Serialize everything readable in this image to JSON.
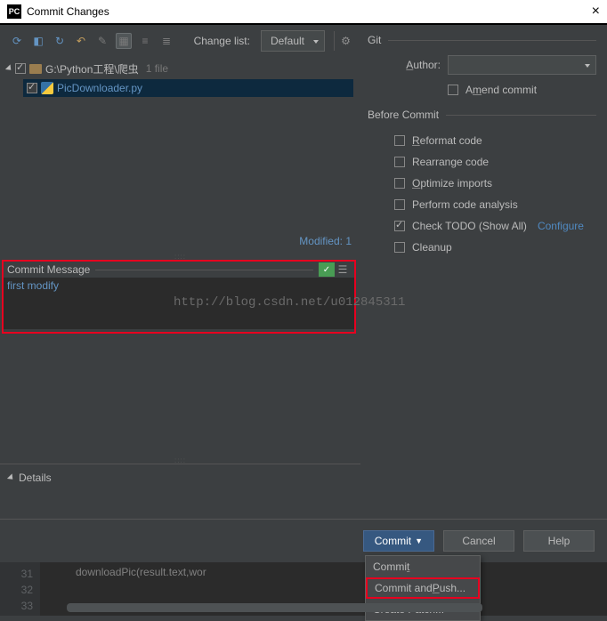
{
  "title_bar": {
    "icon": "PC",
    "title": "Commit Changes",
    "close": "×"
  },
  "toolbar": {
    "change_list_label": "Change list:",
    "change_list_value": "Default"
  },
  "tree": {
    "root_path": "G:\\Python工程\\爬虫",
    "root_suffix": "1 file",
    "file_name": "PicDownloader.py"
  },
  "modified_label": "Modified: 1",
  "commit_section": {
    "title": "Commit Message",
    "message": "first modify"
  },
  "details_label": "Details",
  "git": {
    "header": "Git",
    "author_label": "Author:",
    "amend_label": "Amend commit"
  },
  "before_commit": {
    "header": "Before Commit",
    "items": [
      {
        "label": "Reformat code",
        "checked": false,
        "ul": "R"
      },
      {
        "label": "Rearrange code",
        "checked": false
      },
      {
        "label": "Optimize imports",
        "checked": false,
        "ul": "O"
      },
      {
        "label": "Perform code analysis",
        "checked": false
      },
      {
        "label": "Check TODO (Show All)",
        "checked": true,
        "link": "Configure"
      },
      {
        "label": "Cleanup",
        "checked": false
      }
    ]
  },
  "buttons": {
    "commit": "Commit",
    "cancel": "Cancel",
    "help": "Help"
  },
  "dropdown": {
    "item1": "Commit",
    "item2": "Commit and Push...",
    "item3": "Create Patch..."
  },
  "code": {
    "lines": [
      "31",
      "32",
      "33"
    ],
    "text": "downloadPic(result.text,wor"
  },
  "watermark": "http://blog.csdn.net/u012845311"
}
